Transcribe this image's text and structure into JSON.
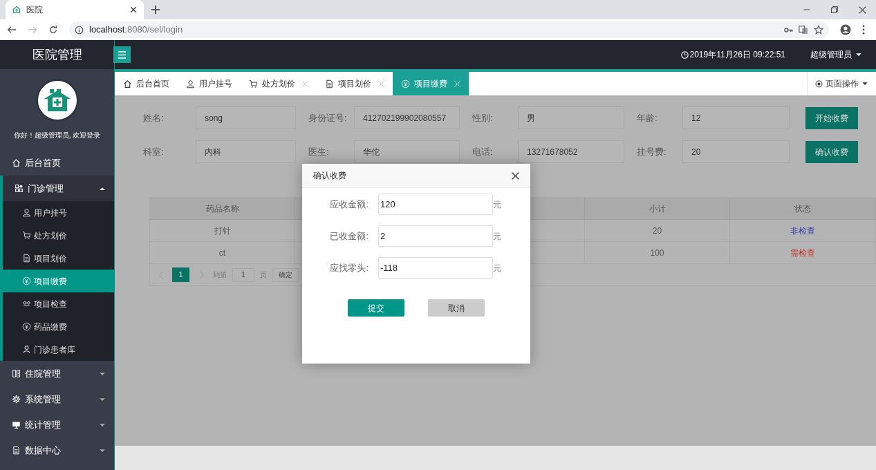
{
  "browser": {
    "tab_title": "医院",
    "url_host": "localhost",
    "url_rest": ":8080/sel/login"
  },
  "app": {
    "title": "医院管理",
    "datetime": "2019年11月26日 09:22:51",
    "user": "超级管理员"
  },
  "sidebar": {
    "greeting": "你好！超级管理员, 欢迎登录",
    "items": [
      {
        "label": "后台首页",
        "kind": "home",
        "selected": false
      },
      {
        "label": "门诊管理",
        "kind": "apps",
        "selected": false,
        "expanded": true,
        "children": [
          {
            "label": "用户挂号",
            "kind": "user",
            "selected": false
          },
          {
            "label": "处方划价",
            "kind": "cart",
            "selected": false
          },
          {
            "label": "项目划价",
            "kind": "doc",
            "selected": false
          },
          {
            "label": "项目缴费",
            "kind": "yen",
            "selected": true
          },
          {
            "label": "项目检查",
            "kind": "link",
            "selected": false
          },
          {
            "label": "药品缴费",
            "kind": "yen",
            "selected": false
          },
          {
            "label": "门诊患者库",
            "kind": "person",
            "selected": false
          }
        ]
      },
      {
        "label": "住院管理",
        "kind": "book",
        "selected": false,
        "expanded": false
      },
      {
        "label": "系统管理",
        "kind": "gear",
        "selected": false,
        "expanded": false
      },
      {
        "label": "统计管理",
        "kind": "screen",
        "selected": false,
        "expanded": false
      },
      {
        "label": "数据中心",
        "kind": "doc",
        "selected": false,
        "expanded": false
      }
    ]
  },
  "tabs": [
    {
      "label": "后台首页",
      "kind": "home",
      "closable": false,
      "selected": false
    },
    {
      "label": "用户挂号",
      "kind": "user",
      "closable": false,
      "selected": false
    },
    {
      "label": "处方划价",
      "kind": "cart",
      "closable": true,
      "selected": false
    },
    {
      "label": "项目划价",
      "kind": "doc",
      "closable": true,
      "selected": false
    },
    {
      "label": "项目缴费",
      "kind": "yen",
      "closable": true,
      "selected": true
    }
  ],
  "page_actions": "页面操作",
  "form": {
    "rows": [
      [
        {
          "label": "姓名:",
          "value": "song"
        },
        {
          "label": "身份证号:",
          "value": "412702199902080557"
        },
        {
          "label": "性别:",
          "value": "男"
        },
        {
          "label": "年龄:",
          "value": "12"
        }
      ],
      [
        {
          "label": "科室:",
          "value": "内科"
        },
        {
          "label": "医生:",
          "value": "华佗"
        },
        {
          "label": "电话:",
          "value": "13271678052"
        },
        {
          "label": "挂号费:",
          "value": "20"
        }
      ]
    ],
    "buttons": [
      "开始收费",
      "确认收费"
    ]
  },
  "table": {
    "columns": [
      {
        "label": "药品名称"
      },
      {},
      {},
      {
        "label": "小计"
      },
      {
        "label": "状态"
      }
    ],
    "rows": [
      {
        "cells": [
          "打针",
          null,
          null,
          "20",
          "非检查"
        ],
        "color": "#3b3bb0"
      },
      {
        "cells": [
          "ct",
          null,
          null,
          "100",
          "需检查"
        ],
        "color": "#c0392b"
      }
    ]
  },
  "pagination": {
    "pages": [
      {
        "label": "1",
        "selected": true
      }
    ],
    "goto_label": "到第",
    "goto_value": "1",
    "page_unit": "页",
    "confirm": "确定"
  },
  "dialog": {
    "title": "确认收费",
    "fields": [
      {
        "label": "应收金额:",
        "value": "120",
        "unit": "元"
      },
      {
        "label": "已收金额:",
        "value": "2",
        "unit": "元"
      },
      {
        "label": "应找零头:",
        "value": "-118",
        "unit": "元"
      }
    ],
    "submit": "提交",
    "cancel": "取消"
  }
}
